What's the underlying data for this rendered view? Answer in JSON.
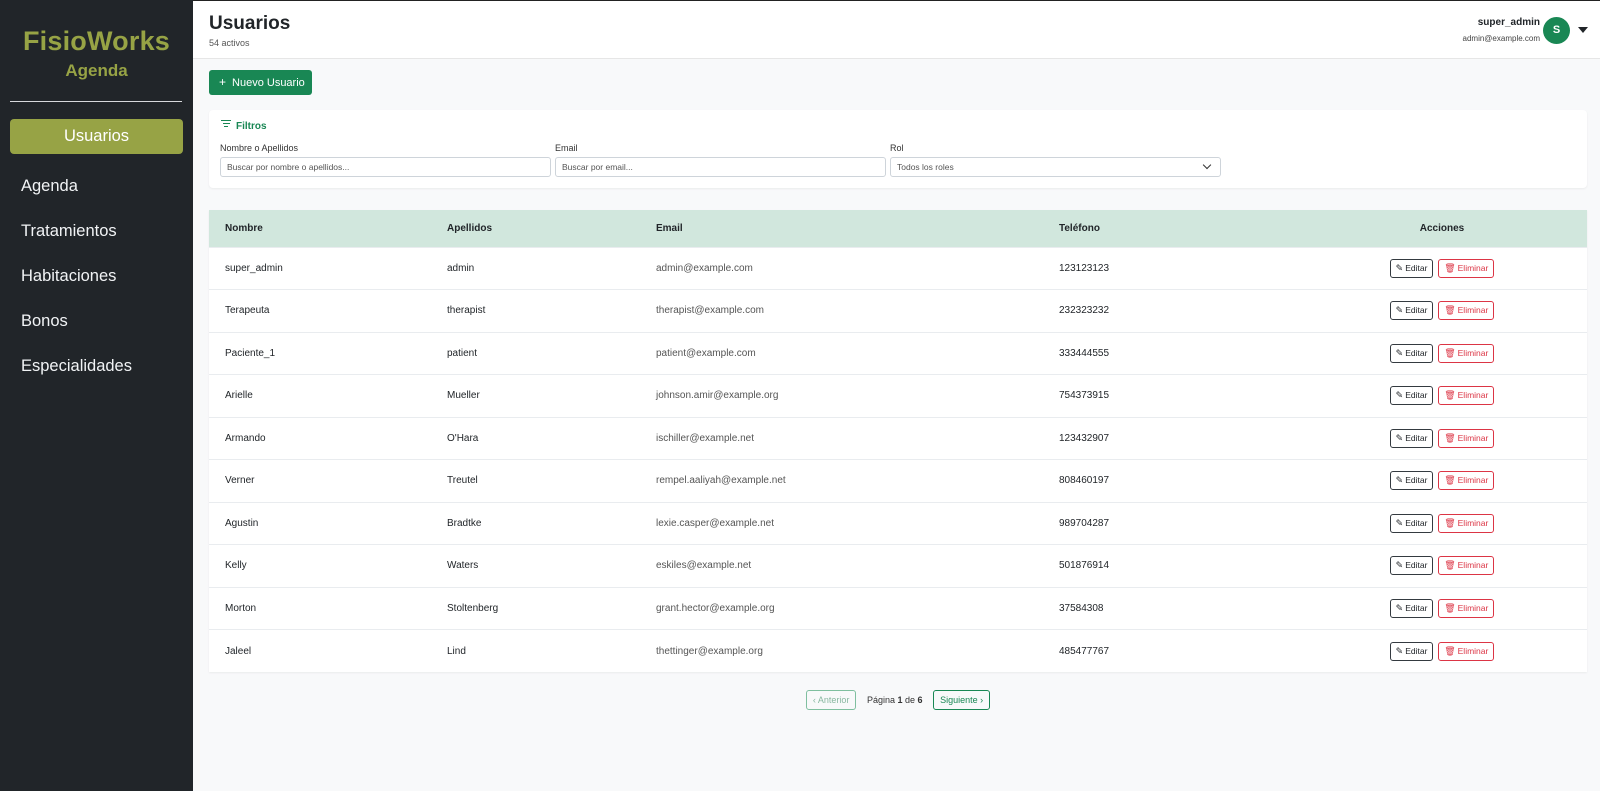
{
  "sidebar": {
    "brand": "FisioWorks",
    "sub": "Agenda",
    "items": [
      {
        "label": "Usuarios",
        "active": true
      },
      {
        "label": "Agenda"
      },
      {
        "label": "Tratamientos"
      },
      {
        "label": "Habitaciones"
      },
      {
        "label": "Bonos"
      },
      {
        "label": "Especialidades"
      }
    ]
  },
  "header": {
    "title": "Usuarios",
    "subtitle": "54 activos",
    "user_name": "super_admin",
    "user_email": "admin@example.com",
    "avatar_initial": "S"
  },
  "toolbar": {
    "new_user_label": "Nuevo Usuario"
  },
  "filters": {
    "title": "Filtros",
    "name_label": "Nombre o Apellidos",
    "name_placeholder": "Buscar por nombre o apellidos...",
    "email_label": "Email",
    "email_placeholder": "Buscar por email...",
    "role_label": "Rol",
    "role_value": "Todos los roles"
  },
  "table": {
    "headers": [
      "Nombre",
      "Apellidos",
      "Email",
      "Teléfono",
      "Acciones"
    ],
    "edit_label": "Editar",
    "delete_label": "Eliminar",
    "rows": [
      [
        "super_admin",
        "admin",
        "admin@example.com",
        "123123123"
      ],
      [
        "Terapeuta",
        "therapist",
        "therapist@example.com",
        "232323232"
      ],
      [
        "Paciente_1",
        "patient",
        "patient@example.com",
        "333444555"
      ],
      [
        "Arielle",
        "Mueller",
        "johnson.amir@example.org",
        "754373915"
      ],
      [
        "Armando",
        "O'Hara",
        "ischiller@example.net",
        "123432907"
      ],
      [
        "Verner",
        "Treutel",
        "rempel.aaliyah@example.net",
        "808460197"
      ],
      [
        "Agustin",
        "Bradtke",
        "lexie.casper@example.net",
        "989704287"
      ],
      [
        "Kelly",
        "Waters",
        "eskiles@example.net",
        "501876914"
      ],
      [
        "Morton",
        "Stoltenberg",
        "grant.hector@example.org",
        "37584308"
      ],
      [
        "Jaleel",
        "Lind",
        "thettinger@example.org",
        "485477767"
      ]
    ]
  },
  "pagination": {
    "prev_label": "Anterior",
    "next_label": "Siguiente",
    "page_word": "Página",
    "of_word": "de",
    "current": "1",
    "total": "6"
  },
  "colors": {
    "brand": "#97a345",
    "primary": "#198754",
    "danger": "#dc3545",
    "sidebar_bg": "#212529",
    "table_head": "#d1e7dd"
  }
}
